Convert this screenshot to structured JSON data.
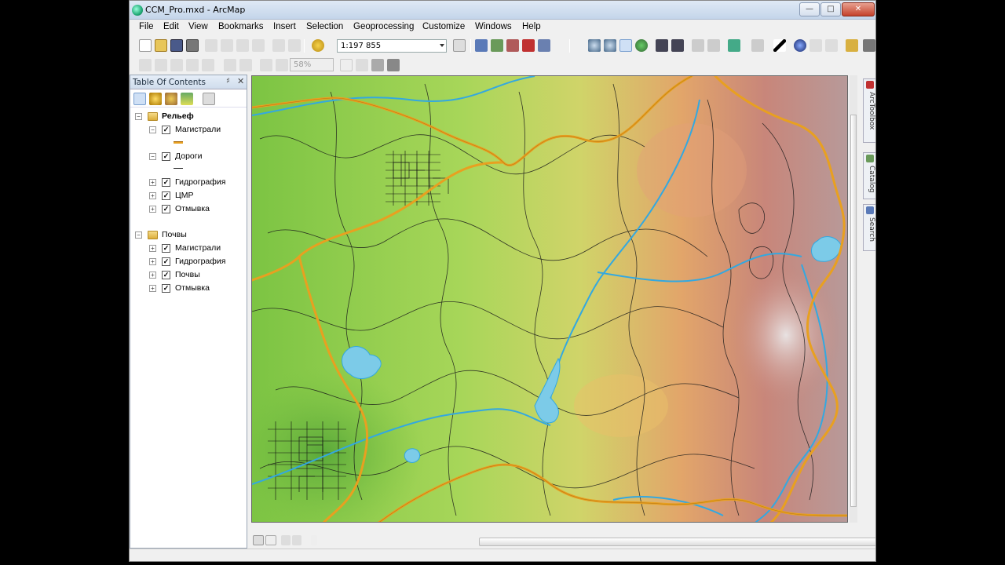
{
  "window": {
    "title": "CCM_Pro.mxd - ArcMap",
    "min_symbol": "—",
    "max_symbol": "□",
    "close_symbol": "✕"
  },
  "menu": [
    "File",
    "Edit",
    "View",
    "Bookmarks",
    "Insert",
    "Selection",
    "Geoprocessing",
    "Customize",
    "Windows",
    "Help"
  ],
  "toolbar": {
    "scale_value": "1:197 855",
    "zoom_percent": "58%"
  },
  "toc": {
    "title": "Table Of Contents",
    "pin_symbol": "♯",
    "close_symbol": "✕",
    "groups": [
      {
        "name": "Рельеф",
        "layers": [
          "Магистрали",
          "Дороги",
          "Гидрография",
          "ЦМР",
          "Отмывка"
        ]
      },
      {
        "name": "Почвы",
        "layers": [
          "Магистрали",
          "Гидрография",
          "Почвы",
          "Отмывка"
        ]
      }
    ]
  },
  "side_tabs": [
    "ArcToolbox",
    "Catalog",
    "Search"
  ],
  "colors": {
    "road_major": "#e8a020",
    "road_minor": "#1a1a1a",
    "water": "#33a8e0",
    "terrain_low": "#8fd14f",
    "terrain_high": "#c8867a"
  },
  "icons": {
    "map": "terrain-map",
    "select": "select-arrow-icon",
    "identify": "identify-icon"
  }
}
